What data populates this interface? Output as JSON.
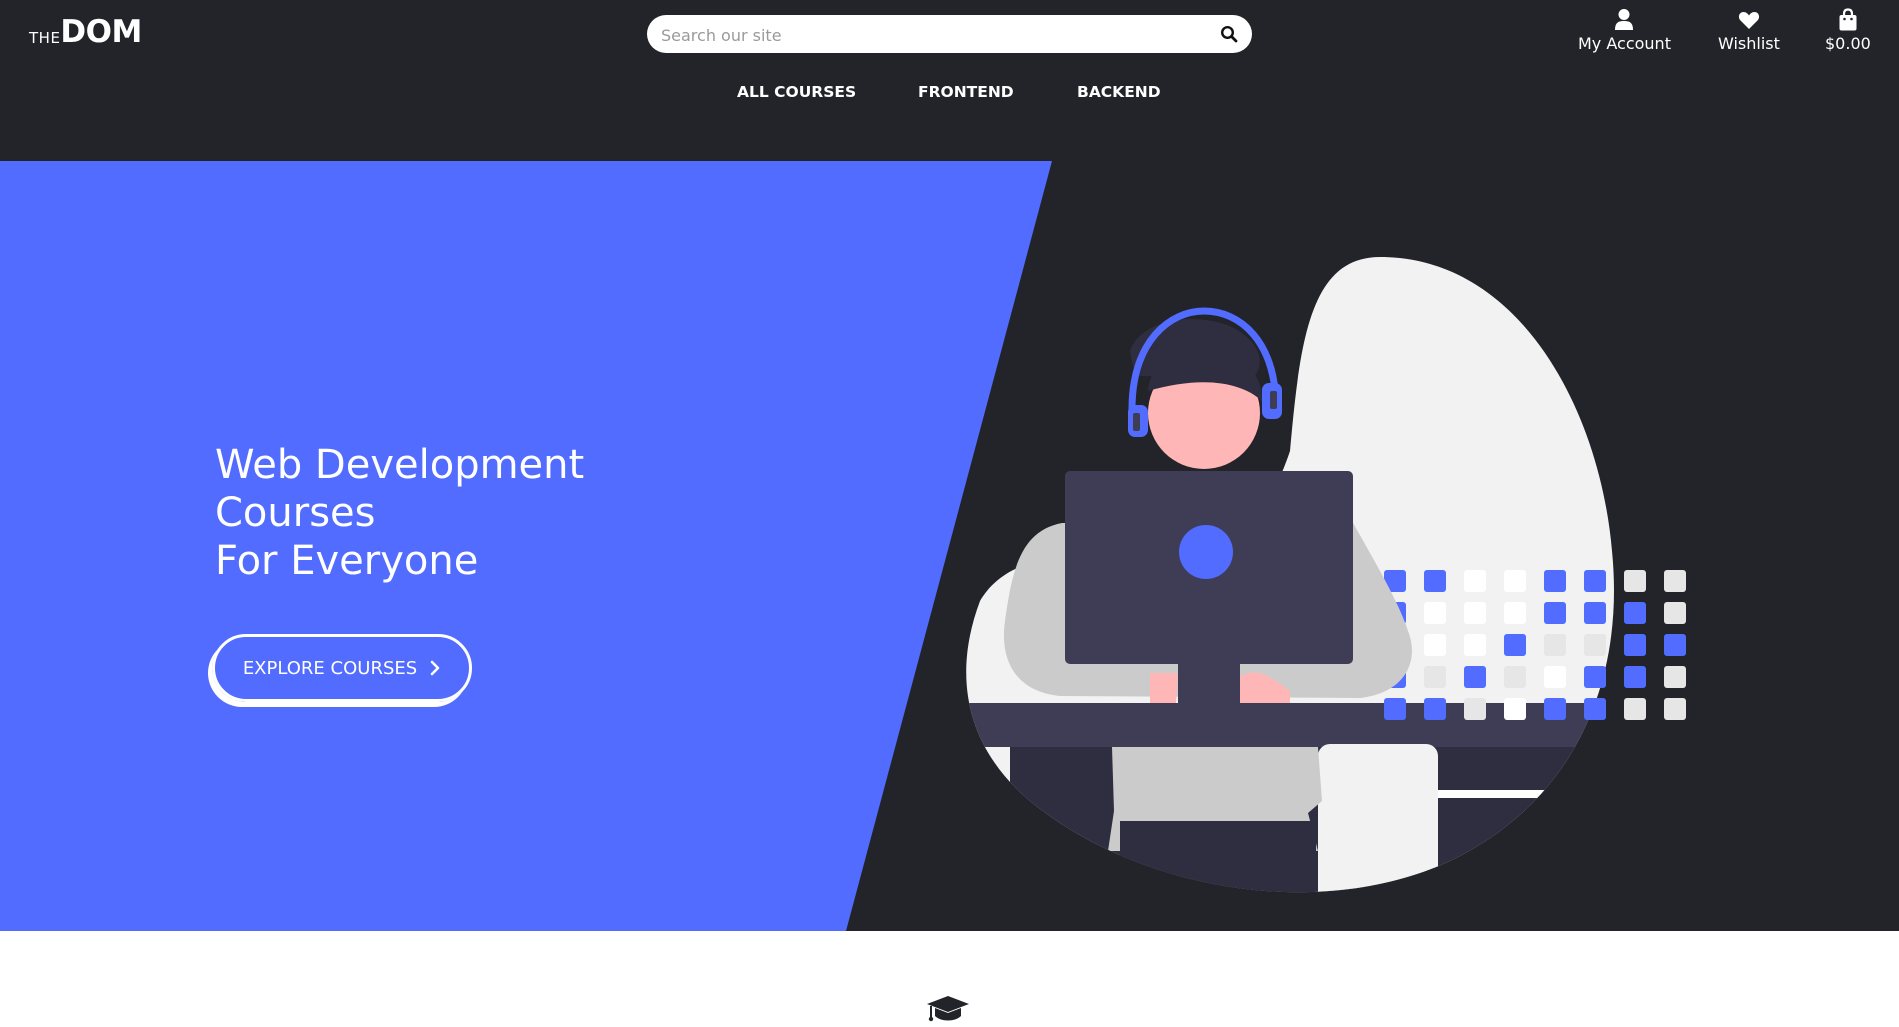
{
  "logo": {
    "prefix": "THE",
    "name": "DOM"
  },
  "search": {
    "placeholder": "Search our site",
    "value": ""
  },
  "header_links": [
    {
      "label": "My Account",
      "icon": "user-icon"
    },
    {
      "label": "Wishlist",
      "icon": "heart-icon"
    },
    {
      "label": "$0.00",
      "icon": "shopping-bag-icon"
    }
  ],
  "main_nav": [
    "ALL COURSES",
    "FRONTEND",
    "BACKEND"
  ],
  "hero": {
    "title_lines": [
      "Web Development",
      "Courses",
      "For Everyone"
    ],
    "cta_label": "EXPLORE COURSES",
    "illustration": "person-with-headphones-at-computer"
  },
  "section_icon": "graduation-cap-icon",
  "colors": {
    "header_bg": "#222429",
    "accent_blue": "#516cfe",
    "monitor": "#3f3d56",
    "skin": "#ffb6b6",
    "blob": "#f2f2f2"
  }
}
